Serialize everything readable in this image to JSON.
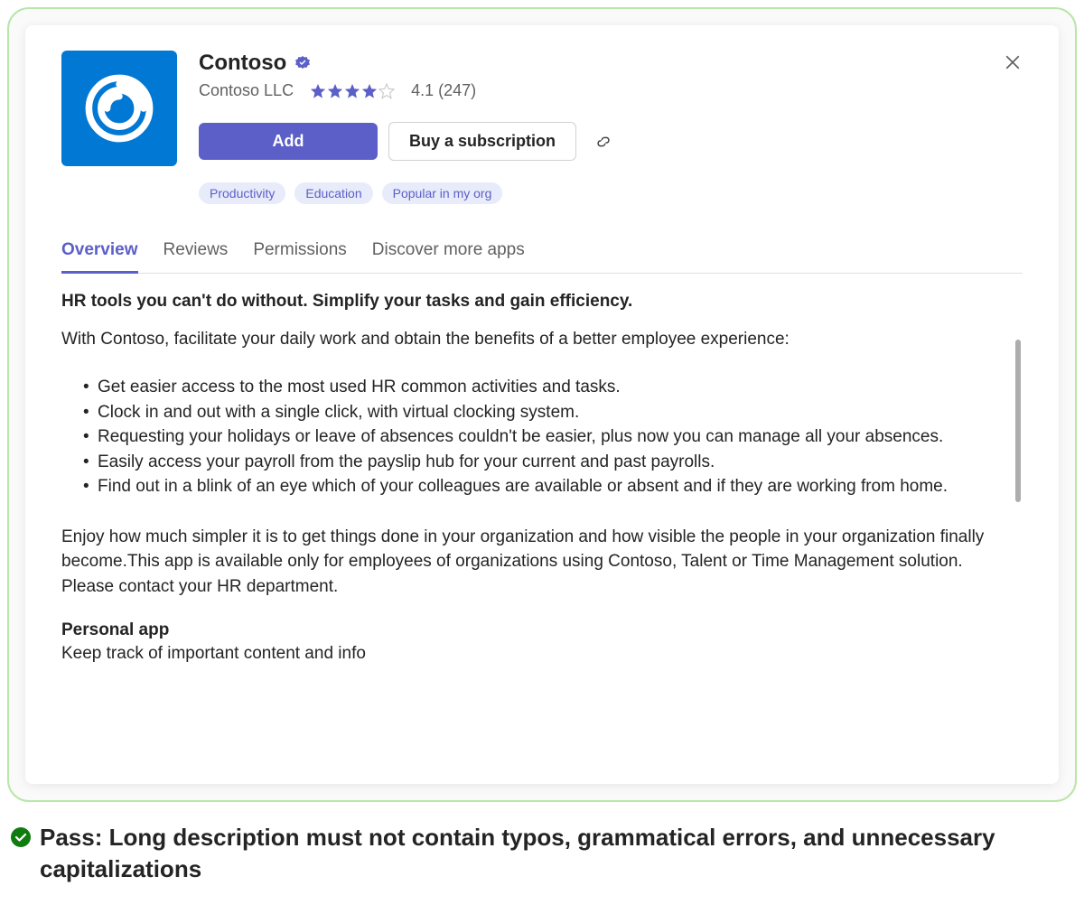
{
  "app": {
    "title": "Contoso",
    "publisher": "Contoso LLC",
    "rating_value": "4.1",
    "rating_count": "247",
    "rating_display": "4.1 (247)",
    "stars_filled": 4,
    "stars_total": 5
  },
  "buttons": {
    "add": "Add",
    "subscribe": "Buy a subscription"
  },
  "tags": [
    "Productivity",
    "Education",
    "Popular in my org"
  ],
  "tabs": [
    "Overview",
    "Reviews",
    "Permissions",
    "Discover more apps"
  ],
  "active_tab": 0,
  "content": {
    "headline": "HR tools you can't do without. Simplify your tasks and gain efficiency.",
    "intro": "With Contoso, facilitate your daily work and obtain the benefits of a better employee experience:",
    "bullets": [
      "Get easier access to the most used HR common activities and tasks.",
      "Clock in and out with a single click, with virtual clocking system.",
      "Requesting your holidays or leave of absences couldn't be easier, plus now you can manage all your absences.",
      "Easily access your payroll from the payslip hub for your current and past payrolls.",
      "Find out in a blink of an eye which of your colleagues are available or absent and if they are working from home."
    ],
    "outro": "Enjoy how much simpler it is to get things done in your organization and how visible the people in your organization finally become.This app is available only for employees of organizations using Contoso, Talent or Time Management solution. Please contact your HR department.",
    "section_title": "Personal app",
    "section_text": "Keep track of important content and info"
  },
  "caption": "Pass: Long description must not contain typos, grammatical errors, and unnecessary capitalizations"
}
